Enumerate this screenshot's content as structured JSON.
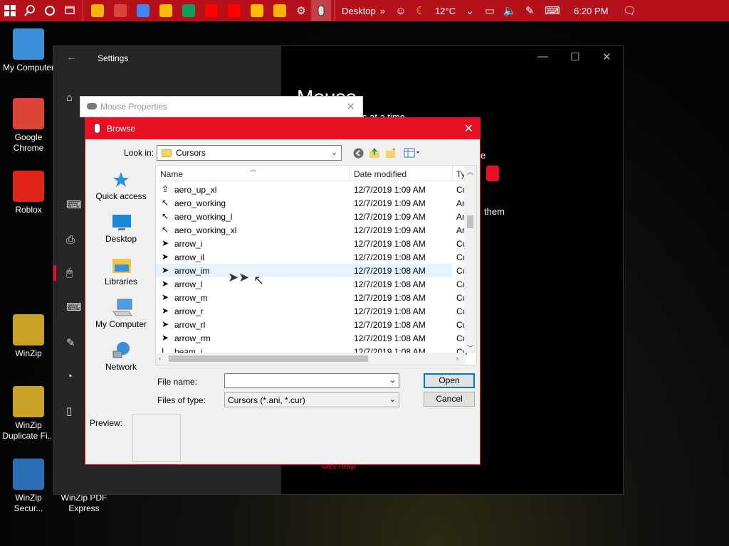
{
  "taskbar": {
    "desktop_label": "Desktop",
    "toolbar_chevron": "»",
    "temperature": "12°C",
    "time": "6:20 PM",
    "app_colors": [
      "#f4b400",
      "#db4437",
      "#4285f4",
      "#fbbc05",
      "#0f9d58",
      "#ff0000",
      "#ff0000",
      "#fbbc05"
    ]
  },
  "desktop": {
    "icons": [
      {
        "label": "My Computer",
        "icon": "monitor-icon",
        "color": "#3a8fd8"
      },
      {
        "label": "Google Chrome",
        "icon": "chrome-icon",
        "color": "#db4437"
      },
      {
        "label": "Roblox",
        "icon": "roblox-icon",
        "color": "#e2231a"
      },
      {
        "label": "WinZip",
        "icon": "winzip-icon",
        "color": "#c9a227"
      },
      {
        "label": "WinZip Duplicate Fi...",
        "icon": "winzip-duplicate-icon",
        "color": "#c9a227"
      },
      {
        "label": "WinZip Secur...",
        "icon": "winzip-secure-icon",
        "color": "#2a6fb5"
      },
      {
        "label": "WinZip PDF Express",
        "icon": "winzip-pdf-icon",
        "color": "#444"
      }
    ]
  },
  "settings": {
    "title": "Settings",
    "heading": "Mouse",
    "text_lines": [
      "s at a time",
      "e",
      "them"
    ],
    "link": "Get help",
    "side_glyphs": [
      "⌂",
      "⌨",
      "⎙",
      "🖱",
      "⌨",
      "✎",
      "◔",
      "▯"
    ]
  },
  "mouse_properties": {
    "title": "Mouse Properties"
  },
  "browse": {
    "title": "Browse",
    "look_in_label": "Look in:",
    "look_in_value": "Cursors",
    "places": [
      "Quick access",
      "Desktop",
      "Libraries",
      "My Computer",
      "Network"
    ],
    "columns": {
      "name": "Name",
      "date": "Date modified",
      "type": "Ty"
    },
    "files": [
      {
        "name": "aero_up_xl",
        "date": "12/7/2019 1:09 AM",
        "type": "Cu",
        "glyph": "⇧"
      },
      {
        "name": "aero_working",
        "date": "12/7/2019 1:09 AM",
        "type": "Ar",
        "glyph": "↖"
      },
      {
        "name": "aero_working_l",
        "date": "12/7/2019 1:09 AM",
        "type": "Ar",
        "glyph": "↖"
      },
      {
        "name": "aero_working_xl",
        "date": "12/7/2019 1:09 AM",
        "type": "Ar",
        "glyph": "↖"
      },
      {
        "name": "arrow_i",
        "date": "12/7/2019 1:08 AM",
        "type": "Cu",
        "glyph": "➤"
      },
      {
        "name": "arrow_il",
        "date": "12/7/2019 1:08 AM",
        "type": "Cu",
        "glyph": "➤"
      },
      {
        "name": "arrow_im",
        "date": "12/7/2019 1:08 AM",
        "type": "Cu",
        "glyph": "➤"
      },
      {
        "name": "arrow_l",
        "date": "12/7/2019 1:08 AM",
        "type": "Cu",
        "glyph": "➤"
      },
      {
        "name": "arrow_m",
        "date": "12/7/2019 1:08 AM",
        "type": "Cu",
        "glyph": "➤"
      },
      {
        "name": "arrow_r",
        "date": "12/7/2019 1:08 AM",
        "type": "Cu",
        "glyph": "➤"
      },
      {
        "name": "arrow_rl",
        "date": "12/7/2019 1:08 AM",
        "type": "Cu",
        "glyph": "➤"
      },
      {
        "name": "arrow_rm",
        "date": "12/7/2019 1:08 AM",
        "type": "Cu",
        "glyph": "➤"
      },
      {
        "name": "beam_i",
        "date": "12/7/2019 1:08 AM",
        "type": "Cu",
        "glyph": "I"
      }
    ],
    "selected_index": 6,
    "file_name_label": "File name:",
    "file_name_value": "",
    "files_of_type_label": "Files of type:",
    "files_of_type_value": "Cursors (*.ani, *.cur)",
    "open_label": "Open",
    "cancel_label": "Cancel",
    "preview_label": "Preview:"
  }
}
